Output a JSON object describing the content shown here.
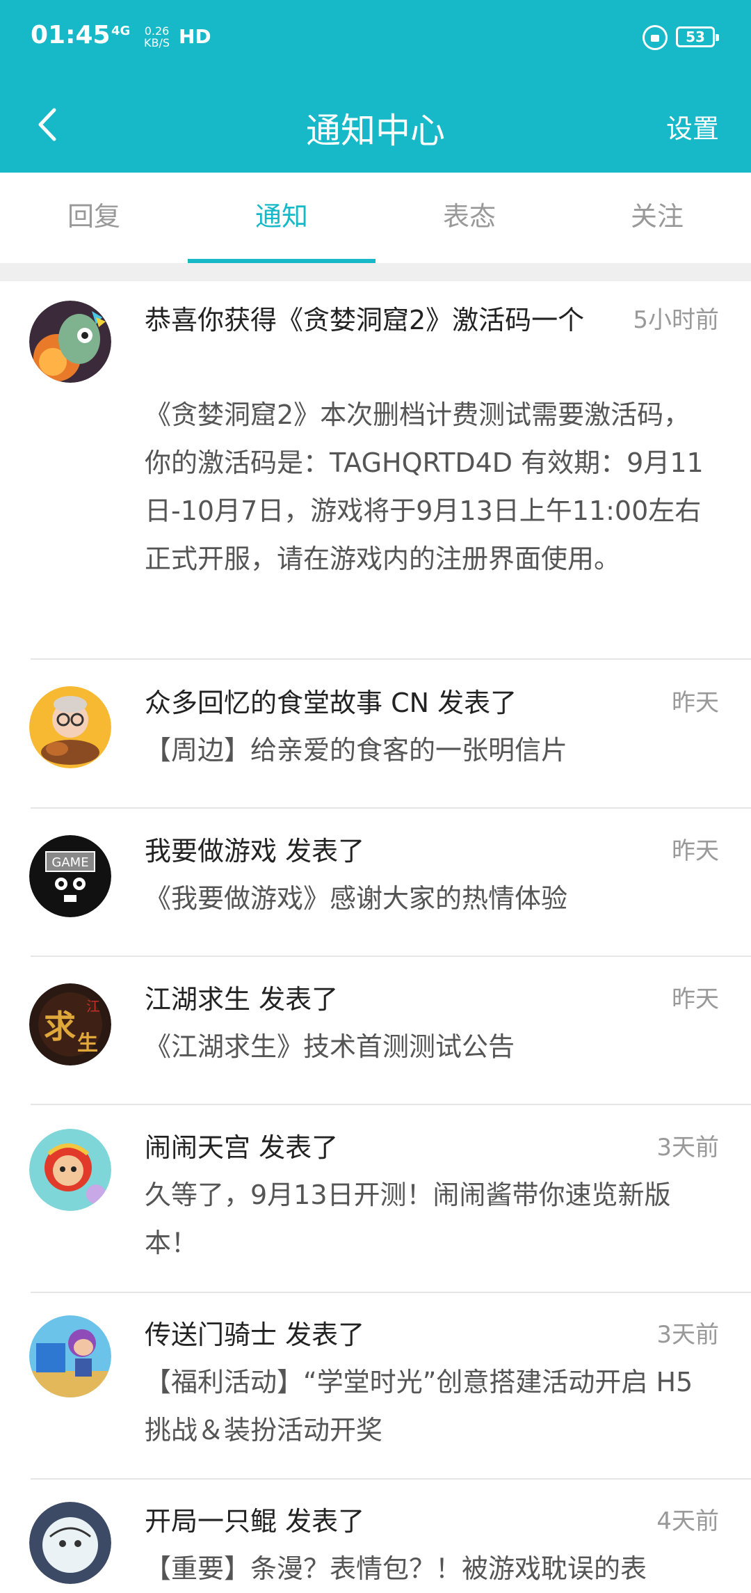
{
  "status_bar": {
    "time": "01:45",
    "signal": "4G",
    "speed_value": "0.26",
    "speed_unit": "KB/S",
    "hd": "HD",
    "battery": "53"
  },
  "header": {
    "title": "通知中心",
    "settings": "设置",
    "background_color": "#17b9c8"
  },
  "tabs": [
    {
      "label": "回复",
      "active": false
    },
    {
      "label": "通知",
      "active": true
    },
    {
      "label": "表态",
      "active": false
    },
    {
      "label": "关注",
      "active": false
    }
  ],
  "notifications": [
    {
      "title": "恭喜你获得《贪婪洞窟2》激活码一个",
      "time": "5小时前",
      "body": "《贪婪洞窟2》本次删档计费测试需要激活码，你的激活码是：TAGHQRTD4D 有效期：9月11日-10月7日，游戏将于9月13日上午11:00左右正式开服，请在游戏内的注册界面使用。",
      "avatar": "game-avatar-greedy-cave"
    },
    {
      "title": "众多回忆的食堂故事 CN 发表了",
      "time": "昨天",
      "body": "【周边】给亲爱的食客的一张明信片",
      "avatar": "game-avatar-canteen"
    },
    {
      "title": "我要做游戏 发表了",
      "time": "昨天",
      "body": "《我要做游戏》感谢大家的热情体验",
      "avatar": "game-avatar-gamemaker"
    },
    {
      "title": "江湖求生 发表了",
      "time": "昨天",
      "body": "《江湖求生》技术首测测试公告",
      "avatar": "game-avatar-jianghu"
    },
    {
      "title": "闹闹天宫 发表了",
      "time": "3天前",
      "body": "久等了，9月13日开测！闹闹酱带你速览新版本！",
      "avatar": "game-avatar-naonao"
    },
    {
      "title": "传送门骑士 发表了",
      "time": "3天前",
      "body": "【福利活动】“学堂时光”创意搭建活动开启 H5挑战＆装扮活动开奖",
      "avatar": "game-avatar-portal-knights"
    },
    {
      "title": "开局一只鲲 发表了",
      "time": "4天前",
      "body": "【重要】条漫？表情包？！被游戏耽误的表",
      "avatar": "game-avatar-kun"
    }
  ]
}
